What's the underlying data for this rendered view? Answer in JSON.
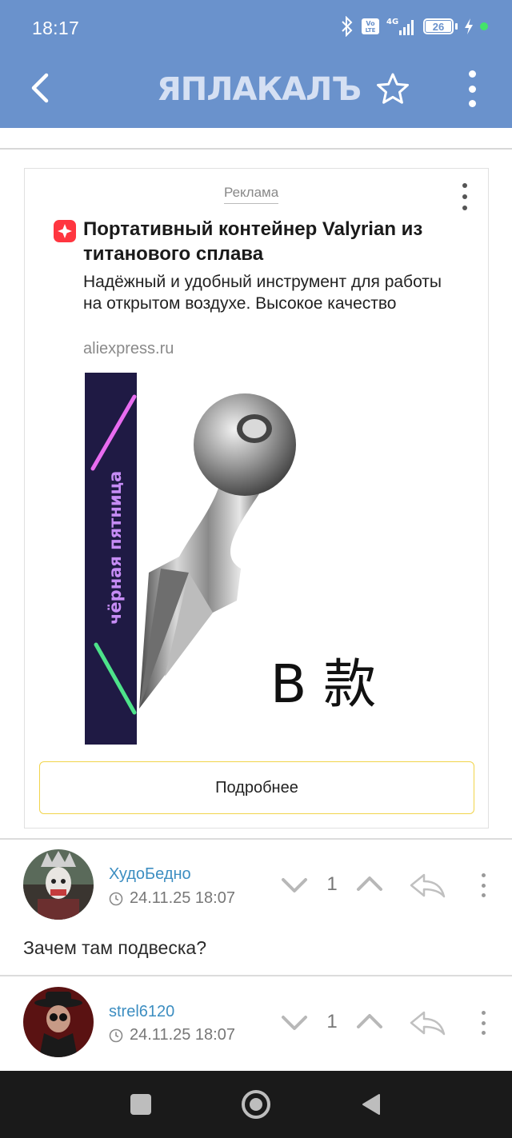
{
  "status_bar": {
    "time": "18:17",
    "network": "4G",
    "volte": "Vo LTE",
    "battery": "26"
  },
  "app_bar": {
    "logo_text": "ЯПЛАКАЛЪ"
  },
  "ad": {
    "label": "Реклама",
    "title": "Портативный контейнер Valyrian из титанового сплава",
    "description": "Надёжный и удобный инструмент для работы на открытом воздухе. Высокое качество",
    "domain": "aliexpress.ru",
    "banner_text": "чёрная пятница",
    "image_caption": "B 款",
    "button_label": "Подробнее"
  },
  "comments": [
    {
      "username": "ХудоБедно",
      "datetime": "24.11.25 18:07",
      "rating": "1",
      "text": "Зачем там подвеска?"
    },
    {
      "username": "strel6120",
      "datetime": "24.11.25 18:07",
      "rating": "1",
      "text": ""
    }
  ],
  "colors": {
    "header": "#6a92cc",
    "username": "#3d8ec1",
    "ad_button_border": "#f1d44a",
    "ad_icon": "#ff3640",
    "navbar": "#1a1a1a"
  }
}
